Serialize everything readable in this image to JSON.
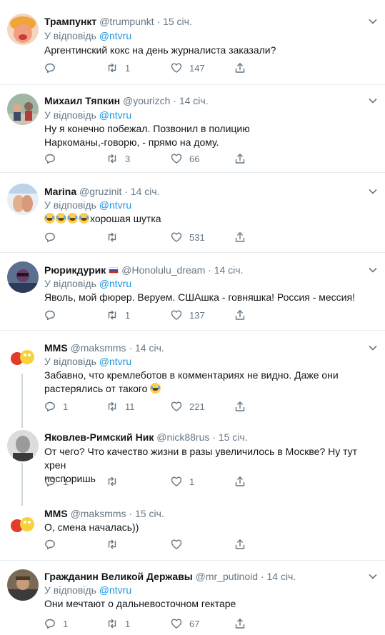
{
  "reply_prefix": "У відповідь",
  "reply_target": "@ntvru",
  "tweets": [
    {
      "name": "Трампункт",
      "handle": "@trumpunkt",
      "time": "15 січ.",
      "text": "Аргентинский кокс на день журналиста заказали?",
      "replies": "",
      "retweets": "1",
      "likes": "147"
    },
    {
      "name": "Михаил Тяпкин",
      "handle": "@yourizch",
      "time": "14 січ.",
      "text": "Ну я конечно побежал. Позвонил в полицию\nНаркоманы,-говорю, -  прямо на дому.",
      "replies": "",
      "retweets": "3",
      "likes": "66"
    },
    {
      "name": "Marina",
      "handle": "@gruzinit",
      "time": "14 січ.",
      "text": "хорошая шутка",
      "replies": "",
      "retweets": "",
      "likes": "531"
    },
    {
      "name": "Рюрикдурик",
      "handle": "@Honolulu_dream",
      "time": "14 січ.",
      "text": "Яволь, мой фюрер. Веруем. СШАшка - говняшка! Россия - мессия!",
      "replies": "",
      "retweets": "1",
      "likes": "137"
    },
    {
      "name": "MMS",
      "handle": "@maksmms",
      "time": "14 січ.",
      "text": "Забавно, что кремлеботов в комментариях не видно. Даже они\nрастерялись от такого",
      "replies": "1",
      "retweets": "11",
      "likes": "221"
    },
    {
      "name": "Яковлев-Римский Ник",
      "handle": "@nick88rus",
      "time": "15 січ.",
      "text": "От чего? Что качество жизни в разы увеличилось в Москве? Ну тут хрен\nпоспоришь",
      "replies": "1",
      "retweets": "",
      "likes": "1"
    },
    {
      "name": "MMS",
      "handle": "@maksmms",
      "time": "15 січ.",
      "text": "О, смена началась))",
      "replies": "",
      "retweets": "",
      "likes": ""
    },
    {
      "name": "Гражданин Великой Державы",
      "handle": "@mr_putinoid",
      "time": "14 січ.",
      "text": "Они мечтают о дальневосточном гектаре",
      "replies": "1",
      "retweets": "1",
      "likes": "67"
    }
  ],
  "icons": [
    "reply-icon",
    "retweet-icon",
    "like-icon",
    "share-icon",
    "caret-down-icon"
  ],
  "colors": {
    "text": "#14171a",
    "muted": "#657786",
    "link": "#1b95e0",
    "divider": "#e6ecf0",
    "thread": "#ccd6dd"
  }
}
